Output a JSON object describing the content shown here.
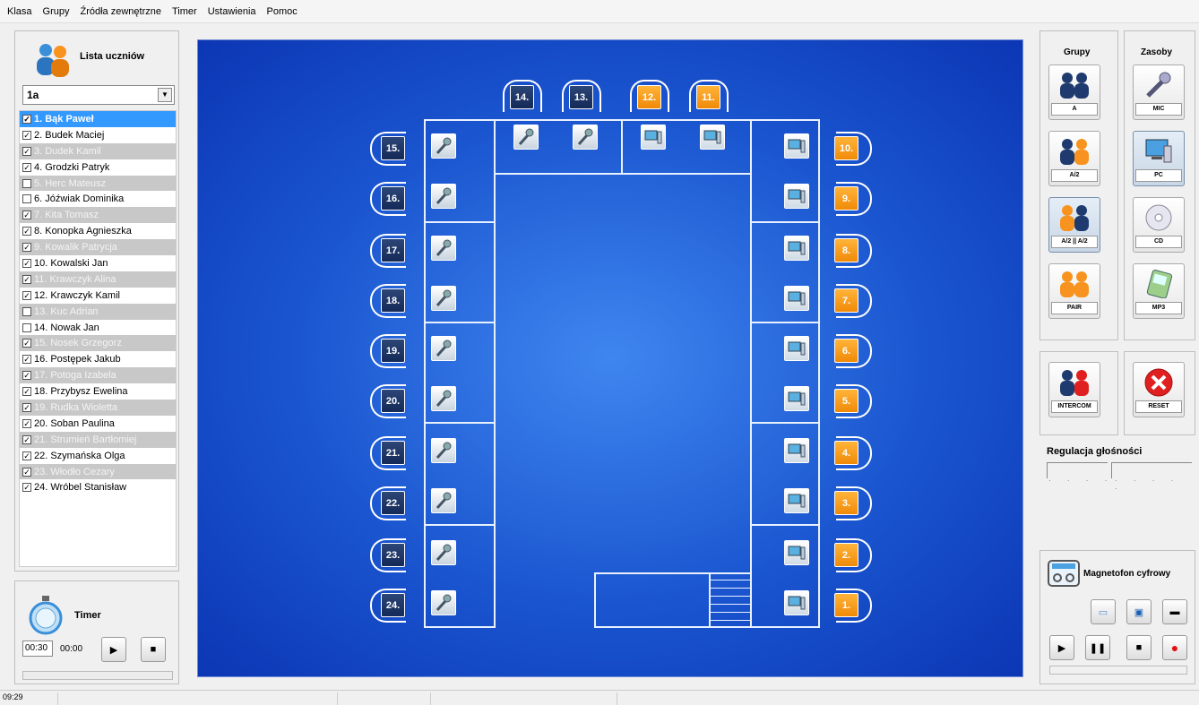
{
  "menu": [
    "Klasa",
    "Grupy",
    "Źródła zewnętrzne",
    "Timer",
    "Ustawienia",
    "Pomoc"
  ],
  "students": {
    "title": "Lista uczniów",
    "class": "1a",
    "items": [
      {
        "label": "1. Bąk Paweł",
        "checked": true,
        "style": "sel"
      },
      {
        "label": "2. Budek Maciej",
        "checked": true,
        "style": ""
      },
      {
        "label": "3. Dudek Kamil",
        "checked": true,
        "style": "alt"
      },
      {
        "label": "4. Grodzki Patryk",
        "checked": true,
        "style": ""
      },
      {
        "label": "5. Herc Mateusz",
        "checked": false,
        "style": "alt"
      },
      {
        "label": "6. Jóźwiak Dominika",
        "checked": false,
        "style": ""
      },
      {
        "label": "7. Kita Tomasz",
        "checked": true,
        "style": "alt"
      },
      {
        "label": "8. Konopka Agnieszka",
        "checked": true,
        "style": ""
      },
      {
        "label": "9. Kowalik Patrycja",
        "checked": true,
        "style": "alt"
      },
      {
        "label": "10. Kowalski Jan",
        "checked": true,
        "style": ""
      },
      {
        "label": "11. Krawczyk Alina",
        "checked": true,
        "style": "alt"
      },
      {
        "label": "12. Krawczyk Kamil",
        "checked": true,
        "style": ""
      },
      {
        "label": "13. Kuc Adrian",
        "checked": false,
        "style": "alt"
      },
      {
        "label": "14. Nowak Jan",
        "checked": false,
        "style": ""
      },
      {
        "label": "15. Nosek Grzegorz",
        "checked": true,
        "style": "alt"
      },
      {
        "label": "16. Postępek Jakub",
        "checked": true,
        "style": ""
      },
      {
        "label": "17. Potoga Izabela",
        "checked": true,
        "style": "alt"
      },
      {
        "label": "18. Przybysz Ewelina",
        "checked": true,
        "style": ""
      },
      {
        "label": "19. Rudka Wioletta",
        "checked": true,
        "style": "alt"
      },
      {
        "label": "20. Soban Paulina",
        "checked": true,
        "style": ""
      },
      {
        "label": "21. Strumień Bartłomiej",
        "checked": true,
        "style": "alt"
      },
      {
        "label": "22. Szymańska Olga",
        "checked": true,
        "style": ""
      },
      {
        "label": "23. Włodło Cezary",
        "checked": true,
        "style": "alt"
      },
      {
        "label": "24. Wróbel Stanisław",
        "checked": true,
        "style": ""
      }
    ]
  },
  "timer": {
    "title": "Timer",
    "set": "00:30",
    "elapsed": "00:00"
  },
  "groups": {
    "title": "Grupy",
    "buttons": [
      {
        "label": "A",
        "active": false
      },
      {
        "label": "A/2",
        "active": false
      },
      {
        "label": "A/2 || A/2",
        "active": true
      },
      {
        "label": "PAIR",
        "active": false
      }
    ]
  },
  "sources": {
    "title": "Zasoby",
    "buttons": [
      {
        "label": "MIC",
        "active": false
      },
      {
        "label": "PC",
        "active": true
      },
      {
        "label": "CD",
        "active": false
      },
      {
        "label": "MP3",
        "active": false
      }
    ]
  },
  "intercom_label": "INTERCOM",
  "reset_label": "RESET",
  "volume_label": "Regulacja głośności",
  "recorder_title": "Magnetofon cyfrowy",
  "status": {
    "time": "09:29"
  },
  "seats_left": [
    "15.",
    "16.",
    "17.",
    "18.",
    "19.",
    "20.",
    "21.",
    "22.",
    "23.",
    "24."
  ],
  "seats_right": [
    "10.",
    "9.",
    "8.",
    "7.",
    "6.",
    "5.",
    "4.",
    "3.",
    "2.",
    "1."
  ],
  "seats_top_navy": [
    "14.",
    "13."
  ],
  "seats_top_orange": [
    "12.",
    "11."
  ],
  "colors": {
    "navy": "#1f3a6e",
    "orange": "#f7931e",
    "room": "#1a55cf"
  }
}
